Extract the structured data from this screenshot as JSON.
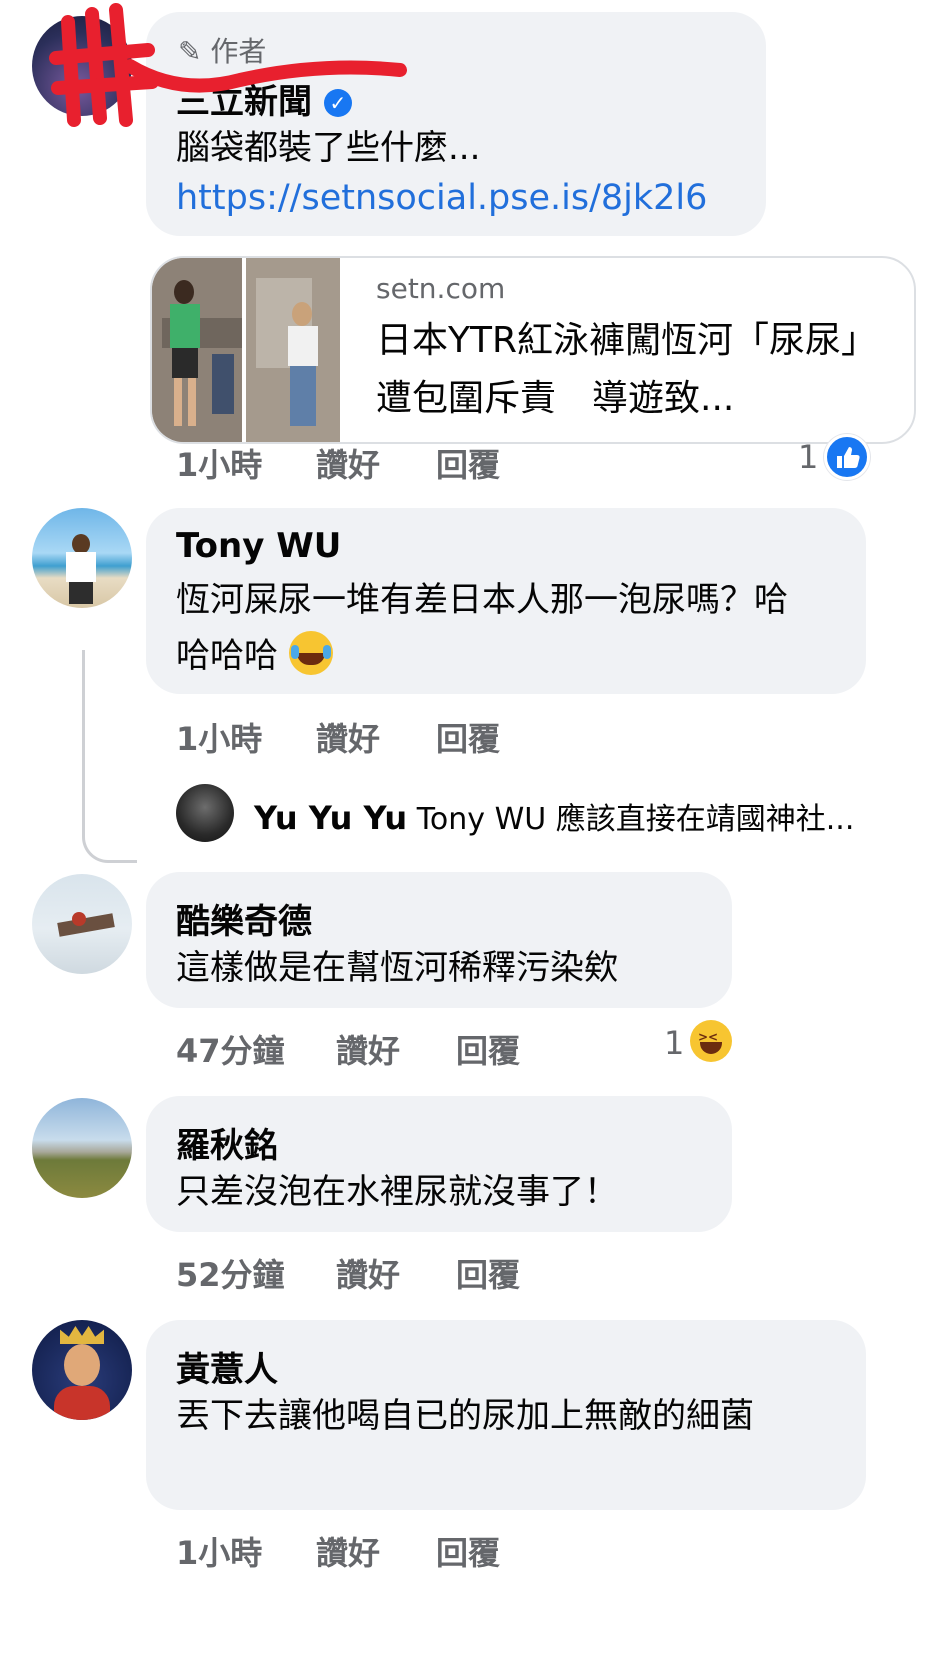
{
  "comments": [
    {
      "author_tag": "作者",
      "name": "三立新聞",
      "text": "腦袋都裝了些什麼...",
      "link": "https://setnsocial.pse.is/8jk2l6",
      "preview": {
        "domain": "setn.com",
        "title": "日本YTR紅泳褲闖恆河「尿尿」遭包圍斥責　導遊致..."
      },
      "time": "1小時",
      "like": "讚好",
      "reply": "回覆",
      "reaction_count": "1",
      "reaction": "like"
    },
    {
      "name": "Tony WU",
      "text": "恆河屎尿一堆有差日本人那一泡尿嗎？哈哈哈哈",
      "time": "1小時",
      "like": "讚好",
      "reply": "回覆",
      "reply_preview": {
        "name": "Yu Yu Yu",
        "text": "Tony WU 應該直接在靖國神社..."
      }
    },
    {
      "name": "酷樂奇德",
      "text": "這樣做是在幫恆河稀釋污染欸",
      "time": "47分鐘",
      "like": "讚好",
      "reply": "回覆",
      "reaction_count": "1",
      "reaction": "haha"
    },
    {
      "name": "羅秋銘",
      "text": "只差沒泡在水裡尿就沒事了！",
      "time": "52分鐘",
      "like": "讚好",
      "reply": "回覆"
    },
    {
      "name": "黃薏人",
      "text": "丟下去讓他喝自已的尿加上無敵的細菌",
      "time": "1小時",
      "like": "讚好",
      "reply": "回覆"
    }
  ],
  "colors": {
    "bubble": "#f0f2f5",
    "link": "#216fdb",
    "meta": "#65676b",
    "like_blue": "#1877f2",
    "verified": "#1877f2",
    "scribble": "#e8202e"
  }
}
